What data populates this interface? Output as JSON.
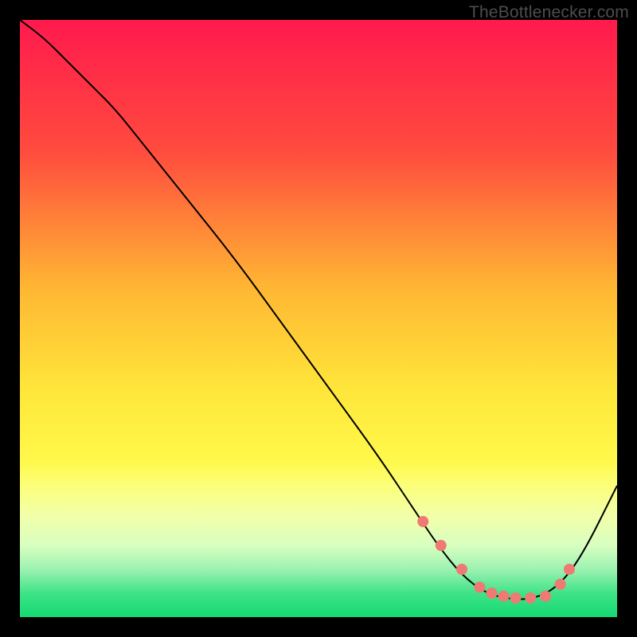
{
  "attribution": "TheBottlenecker.com",
  "chart_data": {
    "type": "line",
    "title": "",
    "xlabel": "",
    "ylabel": "",
    "xlim": [
      0,
      100
    ],
    "ylim": [
      0,
      100
    ],
    "background_gradient": {
      "stops": [
        {
          "pct": 0,
          "color": "#ff1a4d"
        },
        {
          "pct": 22,
          "color": "#ff4b3e"
        },
        {
          "pct": 45,
          "color": "#ffb733"
        },
        {
          "pct": 62,
          "color": "#ffe63a"
        },
        {
          "pct": 74,
          "color": "#fff94b"
        },
        {
          "pct": 78,
          "color": "#fcff7a"
        },
        {
          "pct": 83,
          "color": "#f2ffa9"
        },
        {
          "pct": 88,
          "color": "#d8ffc0"
        },
        {
          "pct": 92,
          "color": "#9cf2b1"
        },
        {
          "pct": 96,
          "color": "#3fe387"
        },
        {
          "pct": 100,
          "color": "#13d973"
        }
      ]
    },
    "series": [
      {
        "name": "bottleneck-curve",
        "color": "#000000",
        "stroke_width": 2,
        "x": [
          0,
          4,
          8,
          12,
          16,
          20,
          28,
          36,
          44,
          52,
          60,
          66,
          70,
          74,
          78,
          82,
          86,
          90,
          94,
          100
        ],
        "y": [
          100,
          97,
          93,
          89,
          85,
          80,
          70,
          60,
          49,
          38,
          27,
          18,
          12,
          7,
          4,
          3,
          3,
          5,
          10,
          22
        ]
      }
    ],
    "markers": {
      "name": "optimal-range-dots",
      "color": "#ef7a74",
      "radius": 7,
      "x": [
        67.5,
        70.5,
        74,
        77,
        79,
        81,
        83,
        85.5,
        88,
        90.5,
        92
      ],
      "y": [
        16,
        12,
        8,
        5,
        4,
        3.5,
        3.2,
        3.2,
        3.5,
        5.5,
        8
      ]
    }
  }
}
